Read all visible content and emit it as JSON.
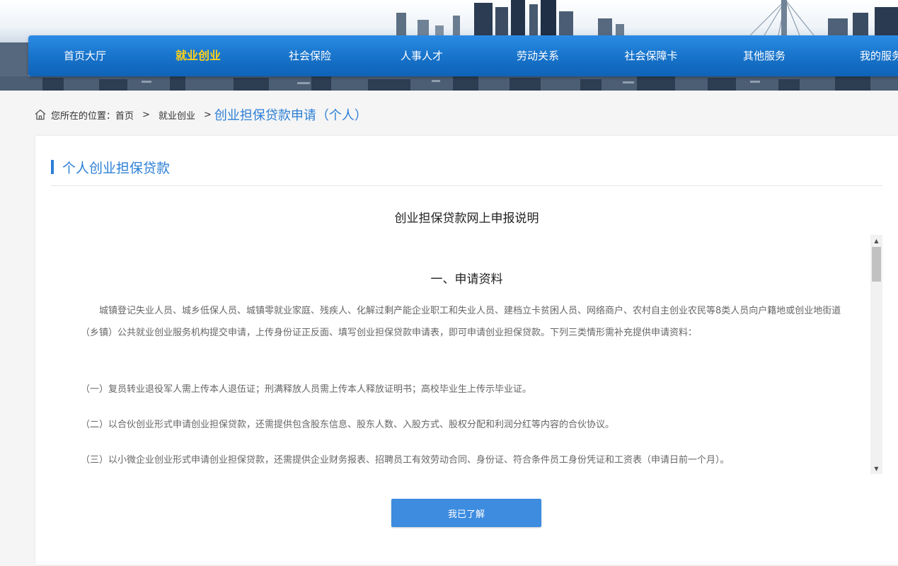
{
  "nav": {
    "items": [
      {
        "label": "首页大厅",
        "active": false
      },
      {
        "label": "就业创业",
        "active": true
      },
      {
        "label": "社会保险",
        "active": false
      },
      {
        "label": "人事人才",
        "active": false
      },
      {
        "label": "劳动关系",
        "active": false
      },
      {
        "label": "社会保障卡",
        "active": false
      },
      {
        "label": "其他服务",
        "active": false
      },
      {
        "label": "我的服务",
        "active": false
      }
    ]
  },
  "breadcrumb": {
    "prefix": "您所在的位置：",
    "home": "首页",
    "separator": ">",
    "section": "就业创业",
    "current": "创业担保贷款申请（个人）"
  },
  "card": {
    "title": "个人创业担保贷款",
    "notice_title": "创业担保贷款网上申报说明",
    "section_title": "一、申请资料",
    "intro": "城镇登记失业人员、城乡低保人员、城镇零就业家庭、残疾人、化解过剩产能企业职工和失业人员、建档立卡贫困人员、网络商户、农村自主创业农民等8类人员向户籍地或创业地街道（乡镇）公共就业创业服务机构提交申请，上传身份证正反面、填写创业担保贷款申请表，即可申请创业担保贷款。下列三类情形需补充提供申请资料：",
    "items": [
      "（一）复员转业退役军人需上传本人退伍证；刑满释放人员需上传本人释放证明书；高校毕业生上传示毕业证。",
      "（二）以合伙创业形式申请创业担保贷款，还需提供包含股东信息、股东人数、入股方式、股权分配和利润分红等内容的合伙协议。",
      "（三）以小微企业创业形式申请创业担保贷款，还需提供企业财务报表、招聘员工有效劳动合同、身份证、符合条件员工身份凭证和工资表（申请日前一个月）。"
    ],
    "ack_button": "我已了解"
  },
  "colors": {
    "nav_blue": "#1772c9",
    "nav_active_text": "#ffd21a",
    "accent_blue": "#2c7fd6",
    "button_blue": "#3d8ce0"
  },
  "icons": {
    "home": "home-icon",
    "scroll_up": "scroll-up-arrow-icon",
    "scroll_down": "scroll-down-arrow-icon"
  }
}
